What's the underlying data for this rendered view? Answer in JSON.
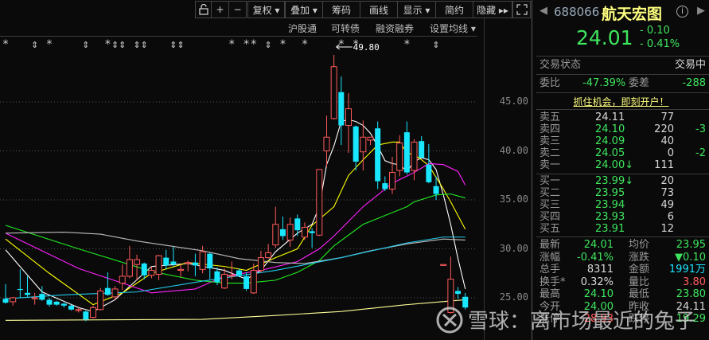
{
  "toolbar": {
    "buttons": [
      {
        "label": "+"
      },
      {
        "label": "−"
      },
      {
        "label": "复权 ▾"
      },
      {
        "label": "叠加 ▾"
      },
      {
        "label": "筹码"
      },
      {
        "label": "画线"
      },
      {
        "label": "显示 ▾"
      },
      {
        "label": "简约"
      },
      {
        "label": "隐藏 ▸▸"
      }
    ],
    "lock_icon": "unlock-icon",
    "fullscreen_icon": "fullscreen-icon"
  },
  "subbar": {
    "items": [
      "沪股通",
      "可转债",
      "融资融券",
      "设置均线 ▾"
    ]
  },
  "chart_data": {
    "type": "candlestick",
    "ylim": [
      21.5,
      50
    ],
    "yticks": [
      "45.00",
      "40.00",
      "35.00",
      "30.00",
      "25.00"
    ],
    "ytick_values": [
      45,
      40,
      35,
      30,
      25
    ],
    "high_annotation": "49.80",
    "high_annotation_index": 45,
    "ohlc": [
      [
        24.9,
        26.4,
        24.4,
        24.5
      ],
      [
        24.6,
        25.1,
        24.2,
        25.0
      ],
      [
        25.9,
        27.9,
        25.0,
        25.8
      ],
      [
        25.5,
        27.2,
        25.1,
        25.3
      ],
      [
        25.0,
        25.5,
        24.3,
        25.0
      ],
      [
        25.4,
        26.2,
        24.7,
        24.8
      ],
      [
        24.8,
        25.0,
        24.1,
        24.3
      ],
      [
        24.6,
        24.7,
        24.2,
        24.3
      ],
      [
        24.4,
        24.5,
        24.0,
        24.2
      ],
      [
        24.2,
        24.3,
        23.7,
        23.8
      ],
      [
        23.8,
        24.0,
        23.5,
        23.8
      ],
      [
        23.6,
        23.7,
        22.6,
        22.8
      ],
      [
        23.0,
        24.2,
        22.9,
        24.0
      ],
      [
        23.8,
        26.0,
        23.7,
        25.7
      ],
      [
        26.0,
        27.6,
        25.2,
        25.3
      ],
      [
        25.1,
        26.2,
        24.8,
        25.9
      ],
      [
        26.5,
        28.4,
        25.8,
        27.2
      ],
      [
        27.2,
        30.3,
        27.0,
        28.9
      ],
      [
        28.4,
        29.4,
        26.8,
        28.9
      ],
      [
        28.5,
        28.6,
        26.9,
        27.3
      ],
      [
        27.3,
        28.2,
        27.0,
        27.8
      ],
      [
        27.4,
        29.4,
        26.8,
        29.3
      ],
      [
        29.1,
        29.9,
        27.9,
        28.3
      ],
      [
        28.7,
        30.2,
        28.2,
        28.4
      ],
      [
        27.9,
        28.5,
        27.1,
        27.9
      ],
      [
        28.6,
        28.8,
        27.7,
        28.6
      ],
      [
        28.6,
        29.5,
        27.2,
        28.3
      ],
      [
        27.9,
        30.3,
        27.5,
        29.7
      ],
      [
        29.5,
        29.6,
        26.9,
        28.0
      ],
      [
        27.7,
        28.1,
        26.3,
        26.6
      ],
      [
        26.0,
        28.0,
        25.9,
        27.4
      ],
      [
        27.3,
        28.7,
        26.9,
        27.3
      ],
      [
        27.8,
        28.0,
        27.1,
        27.3
      ],
      [
        27.2,
        27.6,
        25.7,
        25.9
      ],
      [
        25.5,
        28.5,
        25.4,
        27.8
      ],
      [
        27.8,
        29.8,
        27.6,
        29.1
      ],
      [
        29.1,
        30.5,
        29.0,
        29.6
      ],
      [
        30.4,
        34.3,
        30.1,
        32.5
      ],
      [
        32.0,
        33.3,
        30.9,
        31.3
      ],
      [
        30.9,
        33.2,
        30.2,
        32.5
      ],
      [
        33.1,
        33.5,
        31.3,
        31.9
      ],
      [
        31.2,
        32.7,
        30.9,
        32.2
      ],
      [
        31.8,
        32.1,
        30.1,
        31.6
      ],
      [
        31.4,
        38.1,
        31.3,
        38.1
      ],
      [
        40.0,
        43.6,
        38.4,
        41.4
      ],
      [
        43.3,
        49.8,
        43.2,
        48.6
      ],
      [
        46.0,
        47.6,
        40.6,
        42.6
      ],
      [
        42.6,
        45.9,
        39.8,
        44.3
      ],
      [
        42.5,
        42.6,
        38.0,
        38.9
      ],
      [
        39.9,
        43.1,
        38.0,
        41.4
      ],
      [
        41.1,
        41.4,
        40.6,
        41.4
      ],
      [
        42.3,
        43.0,
        36.1,
        36.9
      ],
      [
        36.7,
        37.4,
        35.9,
        36.1
      ],
      [
        36.1,
        39.4,
        35.6,
        37.8
      ],
      [
        38.0,
        41.6,
        37.4,
        40.8
      ],
      [
        41.9,
        43.0,
        37.6,
        37.8
      ],
      [
        38.0,
        41.2,
        37.0,
        40.9
      ],
      [
        41.0,
        41.5,
        39.3,
        39.3
      ],
      [
        38.6,
        40.7,
        36.7,
        36.8
      ],
      [
        36.4,
        37.4,
        35.0,
        35.6
      ],
      [
        28.4,
        28.4,
        28.4,
        28.4
      ],
      [
        23.5,
        29.2,
        23.4,
        26.9
      ],
      [
        25.7,
        26.1,
        24.9,
        25.4
      ],
      [
        25.1,
        25.5,
        23.8,
        24.01
      ]
    ],
    "ma_lines": [
      {
        "name": "MA5",
        "color": "#ffffff",
        "points": [
          [
            0,
            29.9
          ],
          [
            5,
            25.6
          ],
          [
            10,
            24.0
          ],
          [
            12,
            23.6
          ],
          [
            15,
            24.8
          ],
          [
            20,
            28.2
          ],
          [
            25,
            28.5
          ],
          [
            30,
            27.8
          ],
          [
            33,
            26.9
          ],
          [
            35,
            27.8
          ],
          [
            37,
            29.7
          ],
          [
            40,
            31.6
          ],
          [
            42,
            32.5
          ],
          [
            43,
            34.3
          ],
          [
            44,
            38.6
          ],
          [
            45,
            40.5
          ],
          [
            46,
            43.0
          ],
          [
            47,
            43.2
          ],
          [
            48,
            43.0
          ],
          [
            49,
            42.6
          ],
          [
            50,
            41.8
          ],
          [
            51,
            40.5
          ],
          [
            52,
            39.0
          ],
          [
            53,
            38.7
          ],
          [
            54,
            38.6
          ],
          [
            55,
            37.9
          ],
          [
            56,
            38.9
          ],
          [
            57,
            39.3
          ],
          [
            58,
            39.1
          ],
          [
            59,
            38.1
          ],
          [
            60,
            35.5
          ],
          [
            61,
            32.5
          ],
          [
            62,
            29.0
          ],
          [
            63,
            25.9
          ]
        ]
      },
      {
        "name": "MA10",
        "color": "#ffff00",
        "points": [
          [
            0,
            31.0
          ],
          [
            6,
            27.5
          ],
          [
            12,
            24.3
          ],
          [
            16,
            25.5
          ],
          [
            20,
            27.5
          ],
          [
            25,
            28.6
          ],
          [
            30,
            28.2
          ],
          [
            33,
            27.8
          ],
          [
            37,
            29.1
          ],
          [
            40,
            30.0
          ],
          [
            42,
            32.4
          ],
          [
            45,
            34.3
          ],
          [
            47,
            37.5
          ],
          [
            49,
            39.1
          ],
          [
            51,
            40.6
          ],
          [
            53,
            40.9
          ],
          [
            54,
            40.9
          ],
          [
            55,
            39.8
          ],
          [
            56,
            39.6
          ],
          [
            57,
            39.1
          ],
          [
            58,
            38.5
          ],
          [
            59,
            37.3
          ],
          [
            60,
            36.1
          ],
          [
            61,
            34.8
          ],
          [
            63,
            32.0
          ]
        ]
      },
      {
        "name": "MA20",
        "color": "#ff22ff",
        "points": [
          [
            0,
            31.6
          ],
          [
            10,
            28.0
          ],
          [
            20,
            25.5
          ],
          [
            26,
            25.9
          ],
          [
            30,
            27.2
          ],
          [
            35,
            27.8
          ],
          [
            40,
            28.7
          ],
          [
            43,
            30.0
          ],
          [
            45,
            31.3
          ],
          [
            49,
            34.3
          ],
          [
            53,
            36.7
          ],
          [
            56,
            37.8
          ],
          [
            58,
            38.7
          ],
          [
            60,
            38.6
          ],
          [
            62,
            37.9
          ],
          [
            63,
            36.5
          ]
        ]
      },
      {
        "name": "MA30",
        "color": "#22ee22",
        "points": [
          [
            0,
            32.4
          ],
          [
            10,
            30.0
          ],
          [
            20,
            27.7
          ],
          [
            26,
            26.8
          ],
          [
            30,
            26.5
          ],
          [
            33,
            26.5
          ],
          [
            37,
            26.8
          ],
          [
            40,
            27.6
          ],
          [
            43,
            28.8
          ],
          [
            45,
            30.3
          ],
          [
            49,
            32.5
          ],
          [
            55,
            34.3
          ],
          [
            56,
            34.8
          ],
          [
            59,
            35.5
          ],
          [
            61,
            35.6
          ],
          [
            63,
            35.2
          ]
        ]
      },
      {
        "name": "MA60",
        "color": "#bdbdbd",
        "points": [
          [
            0,
            31.6
          ],
          [
            8,
            31.7
          ],
          [
            13,
            31.5
          ],
          [
            18,
            30.8
          ],
          [
            27,
            29.8
          ],
          [
            32,
            29.0
          ],
          [
            37,
            28.6
          ],
          [
            41,
            28.5
          ],
          [
            46,
            29.1
          ],
          [
            50,
            29.8
          ],
          [
            55,
            30.5
          ],
          [
            60,
            31.0
          ],
          [
            63,
            30.9
          ]
        ]
      },
      {
        "name": "MA120",
        "color": "#22ccee",
        "points": [
          [
            0,
            24.9
          ],
          [
            8,
            25.3
          ],
          [
            18,
            25.6
          ],
          [
            27,
            26.7
          ],
          [
            37,
            27.8
          ],
          [
            46,
            29.1
          ],
          [
            55,
            30.6
          ],
          [
            60,
            31.2
          ],
          [
            63,
            31.2
          ]
        ]
      },
      {
        "name": "MA250",
        "color": "#ffff99",
        "points": [
          [
            0,
            22.7
          ],
          [
            27,
            22.8
          ],
          [
            37,
            23.2
          ],
          [
            46,
            23.6
          ],
          [
            55,
            24.3
          ],
          [
            63,
            24.8
          ]
        ]
      }
    ],
    "event_markers": [
      [
        0,
        "*"
      ],
      [
        4,
        "⇕"
      ],
      [
        6,
        "*"
      ],
      [
        11,
        "⇕"
      ],
      [
        14,
        "*"
      ],
      [
        15,
        "⇕"
      ],
      [
        16,
        "⇕"
      ],
      [
        18,
        "⇕"
      ],
      [
        19,
        "⇕"
      ],
      [
        23,
        "⇕"
      ],
      [
        24,
        "⇕"
      ],
      [
        31,
        "*"
      ],
      [
        33,
        "*"
      ],
      [
        34,
        "*"
      ],
      [
        36,
        "⇕"
      ],
      [
        38,
        "*"
      ],
      [
        41,
        "*"
      ],
      [
        46,
        "*"
      ],
      [
        48,
        "*"
      ],
      [
        55,
        "*"
      ],
      [
        59,
        "⇕"
      ]
    ],
    "up_color": "#ff5a5a",
    "down_color": "#19e6ff"
  },
  "quote": {
    "code": "688066",
    "name": "航天宏图",
    "price": "24.01",
    "change": "- 0.10",
    "change_pct": "- 0.41%",
    "info_icon": "info-icon"
  },
  "status": {
    "label": "交易状态",
    "value": "交易中"
  },
  "ratio": {
    "label": "委比",
    "value": "-47.39%",
    "diff_label": "委差",
    "diff_value": "-288"
  },
  "promo": "抓住机会，即刻开户！",
  "asks": [
    {
      "label": "卖五",
      "price": "24.11",
      "vol": "77",
      "chg": ""
    },
    {
      "label": "卖四",
      "price": "24.10",
      "vol": "220",
      "chg": "-3"
    },
    {
      "label": "卖三",
      "price": "24.09",
      "vol": "40",
      "chg": ""
    },
    {
      "label": "卖二",
      "price": "24.05",
      "vol": "0",
      "chg": "-2"
    },
    {
      "label": "卖一",
      "price": "24.00↓",
      "vol": "111",
      "chg": ""
    }
  ],
  "bids": [
    {
      "label": "买一",
      "price": "23.99↓",
      "vol": "20"
    },
    {
      "label": "买二",
      "price": "23.95",
      "vol": "73"
    },
    {
      "label": "买三",
      "price": "23.94",
      "vol": "49"
    },
    {
      "label": "买四",
      "price": "23.93",
      "vol": "6"
    },
    {
      "label": "买五",
      "price": "23.91",
      "vol": "12"
    }
  ],
  "stats": [
    {
      "l1": "最新",
      "v1": "24.01",
      "c1": "g",
      "l2": "均价",
      "v2": "23.95",
      "c2": "g"
    },
    {
      "l1": "涨幅",
      "v1": "-0.41%",
      "c1": "g",
      "l2": "涨跌",
      "v2": "▼0.10",
      "c2": "g"
    },
    {
      "l1": "总手",
      "v1": "8311",
      "c1": "w",
      "l2": "金额",
      "v2": "1991万",
      "c2": "c"
    },
    {
      "l1": "换手*",
      "v1": "0.32%",
      "c1": "w",
      "l2": "量比",
      "v2": "3.80",
      "c2": "r"
    },
    {
      "l1": "最高",
      "v1": "24.10",
      "c1": "g",
      "l2": "最低",
      "v2": "23.80",
      "c2": "g"
    },
    {
      "l1": "今开",
      "v1": "24.00",
      "c1": "g",
      "l2": "昨收",
      "v2": "24.11",
      "c2": "w"
    },
    {
      "l1": "涨停",
      "v1": "28.93",
      "c1": "r",
      "l2": "跌停",
      "v2": "19.29",
      "c2": "g"
    }
  ],
  "watermark": "雪球：离市场最近的兔子"
}
